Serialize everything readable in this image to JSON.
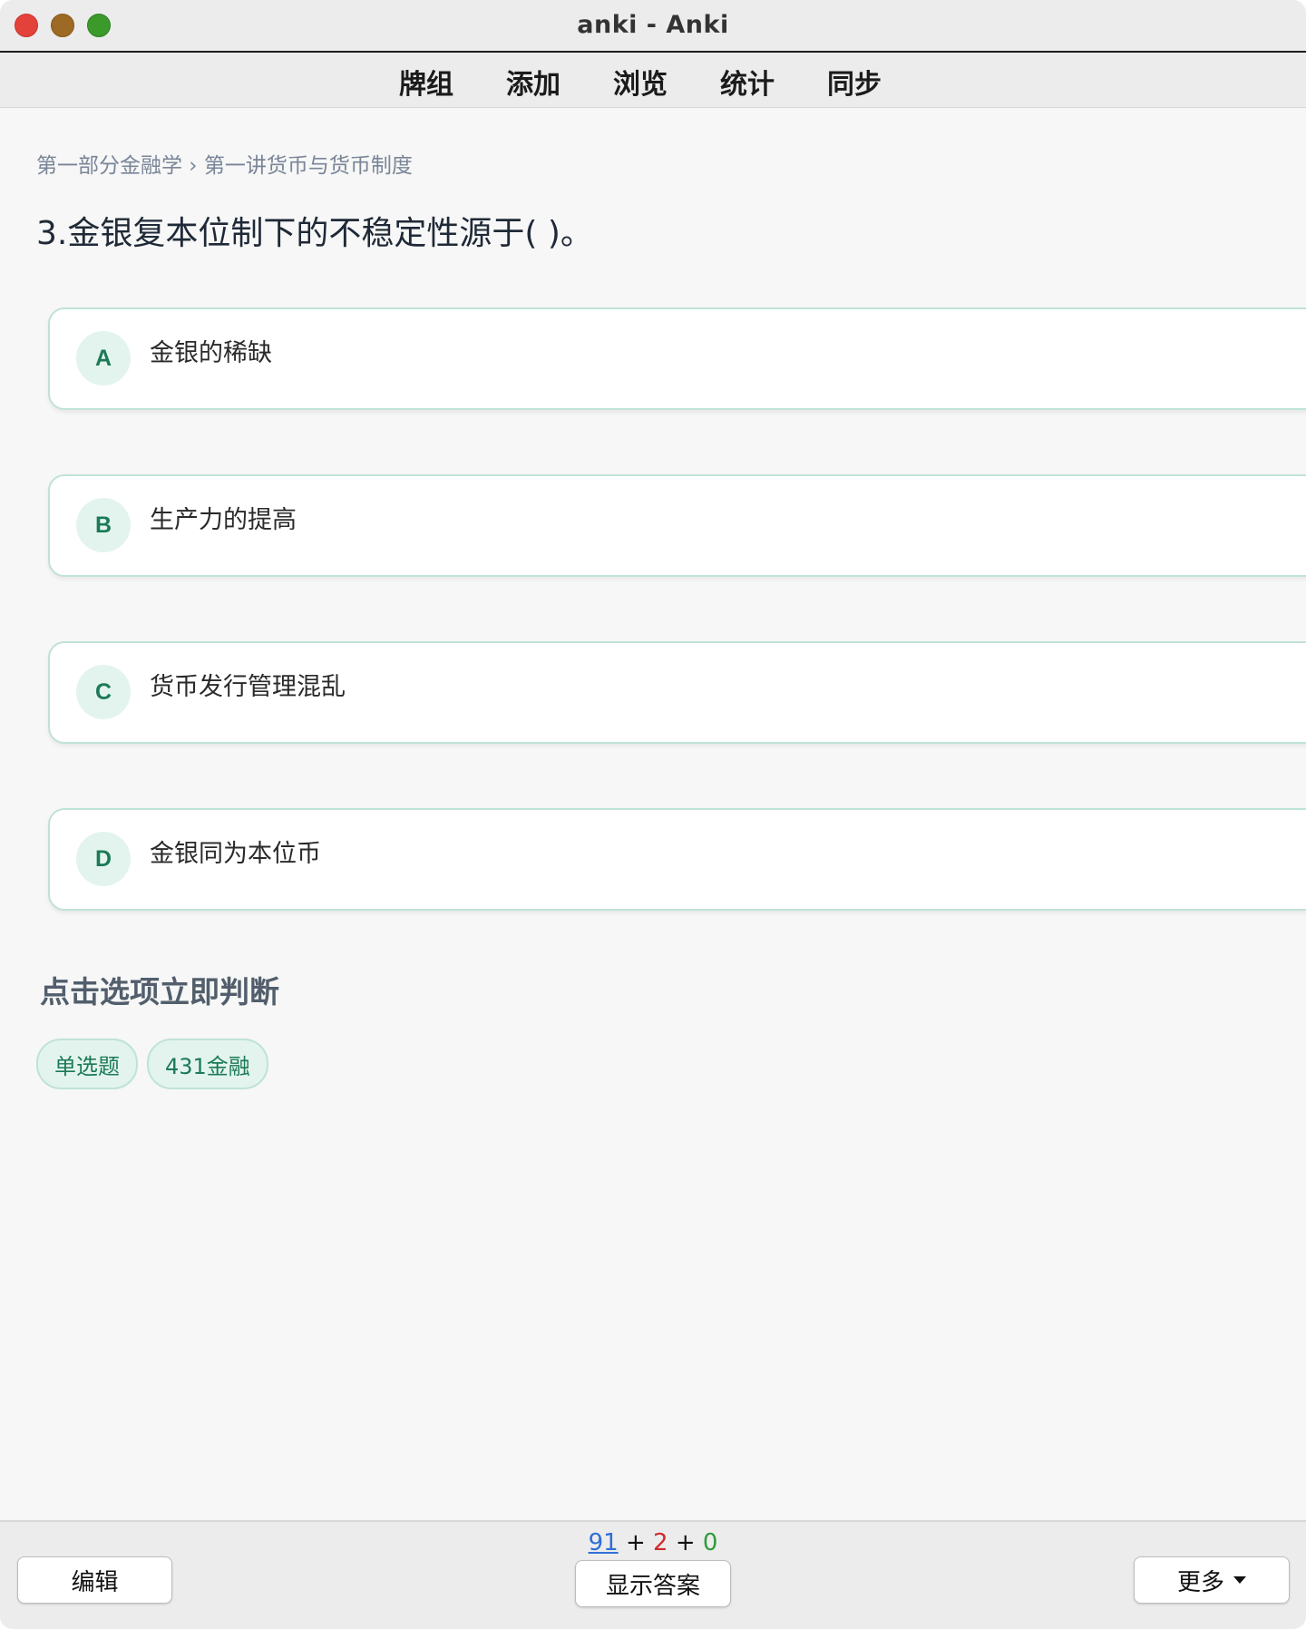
{
  "window": {
    "title": "anki - Anki"
  },
  "nav": {
    "items": [
      "牌组",
      "添加",
      "浏览",
      "统计",
      "同步"
    ]
  },
  "card": {
    "breadcrumb": "第一部分金融学 › 第一讲货币与货币制度",
    "question": "3.金银复本位制下的不稳定性源于( )。",
    "options": [
      {
        "letter": "A",
        "text": "金银的稀缺"
      },
      {
        "letter": "B",
        "text": "生产力的提高"
      },
      {
        "letter": "C",
        "text": "货币发行管理混乱"
      },
      {
        "letter": "D",
        "text": "金银同为本位币"
      }
    ],
    "hint": "点击选项立即判断",
    "tags": [
      "单选题",
      "431金融"
    ]
  },
  "bottom": {
    "counts": {
      "new": "91",
      "learn": "2",
      "review": "0",
      "sep": "+"
    },
    "edit_label": "编辑",
    "show_answer_label": "显示答案",
    "more_label": "更多"
  },
  "colors": {
    "accent_green": "#1c7a57",
    "option_border": "#bfe3d6",
    "badge_bg": "#e3f4ee",
    "count_new": "#2f6fd6",
    "count_learn": "#d02b2b",
    "count_review": "#2e9b3a"
  },
  "icons": {
    "more_caret": "caret-down-icon"
  }
}
